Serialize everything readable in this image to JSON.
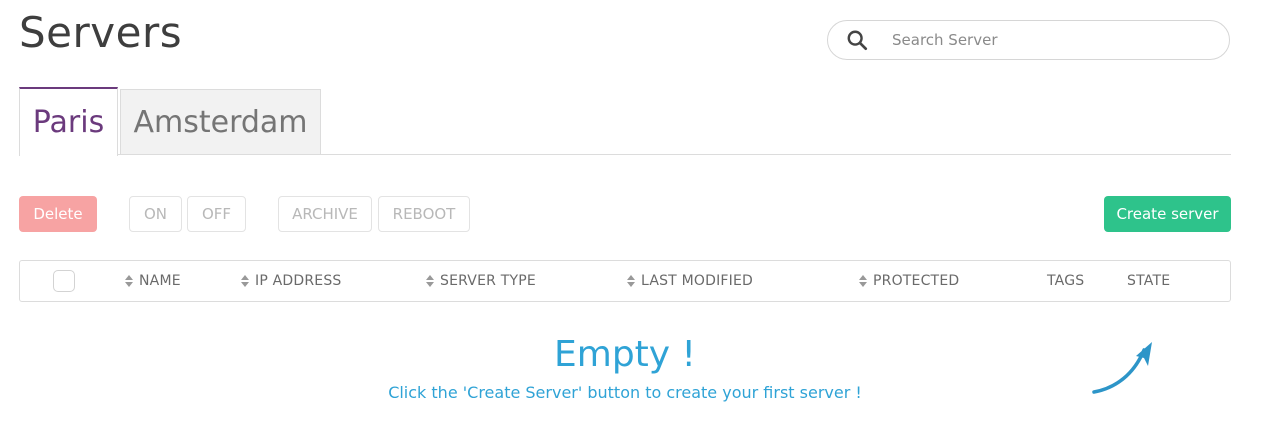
{
  "page": {
    "title": "Servers"
  },
  "search": {
    "placeholder": "Search Server",
    "value": ""
  },
  "tabs": [
    {
      "label": "Paris",
      "active": true
    },
    {
      "label": "Amsterdam",
      "active": false
    }
  ],
  "toolbar": {
    "delete_label": "Delete",
    "on_label": "ON",
    "off_label": "OFF",
    "archive_label": "ARCHIVE",
    "reboot_label": "REBOOT",
    "create_label": "Create server"
  },
  "table": {
    "columns": [
      "NAME",
      "IP ADDRESS",
      "SERVER TYPE",
      "LAST MODIFIED",
      "PROTECTED",
      "TAGS",
      "STATE"
    ]
  },
  "empty": {
    "title": "Empty !",
    "message": "Click the 'Create Server' button to create your first server !"
  },
  "colors": {
    "accent": "#6b3a7d",
    "delete": "#f7a3a3",
    "create": "#2ec38b",
    "empty_text": "#2fa3d6"
  },
  "icons": {
    "search": "search-icon",
    "sort": "sort-icon",
    "arrow": "arrow-icon"
  }
}
